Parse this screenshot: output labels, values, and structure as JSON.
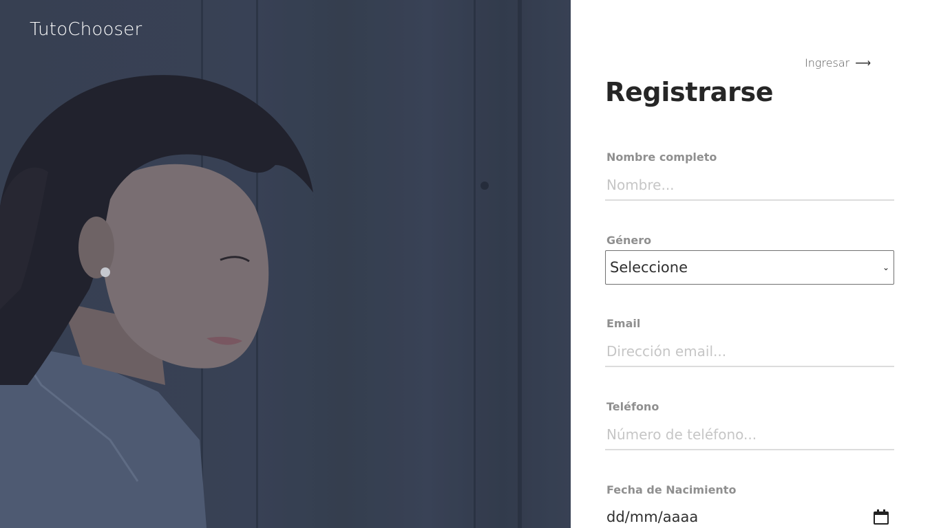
{
  "brand": "TutoChooser",
  "login_link": {
    "label": "Ingresar",
    "icon": "arrow-right-icon"
  },
  "title": "Registrarse",
  "fields": {
    "name": {
      "label": "Nombre completo",
      "placeholder": "Nombre..."
    },
    "gender": {
      "label": "Género",
      "selected": "Seleccione"
    },
    "email": {
      "label": "Email",
      "placeholder": "Dirección email..."
    },
    "phone": {
      "label": "Teléfono",
      "placeholder": "Número de teléfono..."
    },
    "birthdate": {
      "label": "Fecha de Nacimiento",
      "value": "dd/mm/aaaa",
      "icon": "calendar-icon"
    }
  },
  "colors": {
    "hero_tint": "#3b4457",
    "title": "#262626",
    "label": "#8f8f8f",
    "placeholder": "#c6c6c6",
    "underline": "#dcdcdc"
  }
}
